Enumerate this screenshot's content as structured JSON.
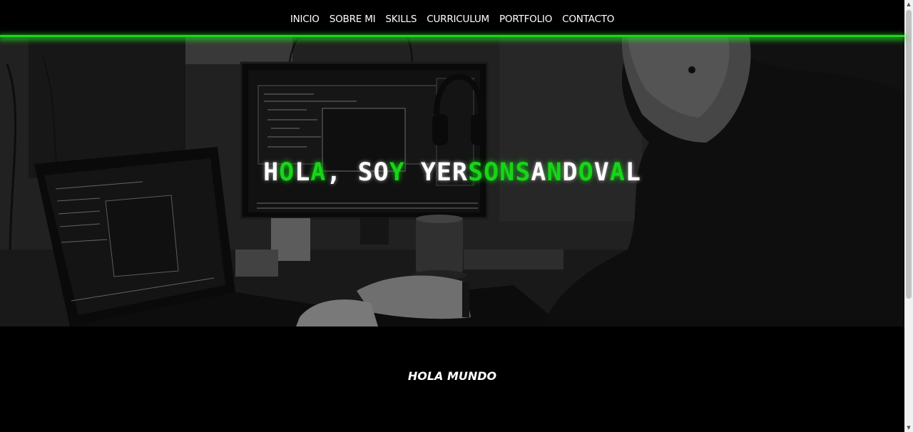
{
  "nav": {
    "items": [
      {
        "label": "INICIO"
      },
      {
        "label": "SOBRE MI"
      },
      {
        "label": "SKILLS"
      },
      {
        "label": "CURRICULUM"
      },
      {
        "label": "PORTFOLIO"
      },
      {
        "label": "CONTACTO"
      }
    ]
  },
  "hero": {
    "title": "HOLA, SOY YERSONSANDOVAL",
    "accent_color": "#18d418"
  },
  "section": {
    "heading": "HOLA MUNDO"
  },
  "colors": {
    "background": "#000000",
    "accent_green": "#1fd31f",
    "text": "#ffffff"
  },
  "icons": {
    "scroll_up": "chevron-up-icon",
    "scroll_down": "chevron-down-icon"
  }
}
